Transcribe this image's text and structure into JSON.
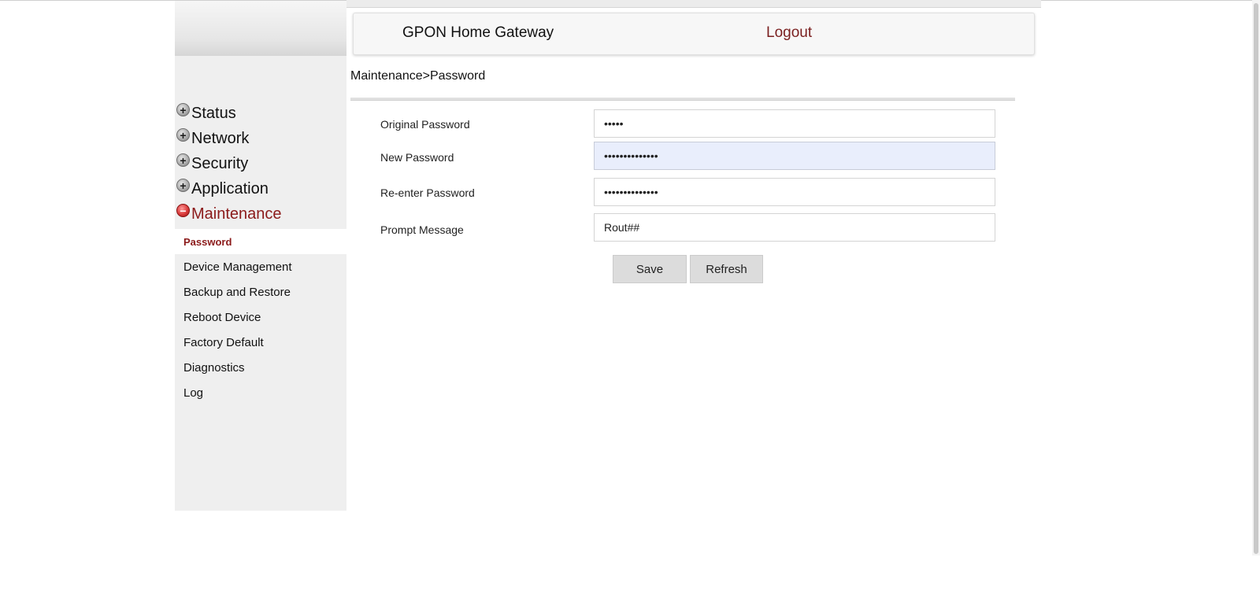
{
  "header": {
    "title": "GPON Home Gateway",
    "logout_label": "Logout"
  },
  "breadcrumb": "Maintenance>Password",
  "sidebar": {
    "menu": [
      {
        "label": "Status",
        "expander": "+"
      },
      {
        "label": "Network",
        "expander": "+"
      },
      {
        "label": "Security",
        "expander": "+"
      },
      {
        "label": "Application",
        "expander": "+"
      },
      {
        "label": "Maintenance",
        "expander": "−"
      }
    ],
    "maintenance_items": [
      {
        "label": "Password"
      },
      {
        "label": "Device Management"
      },
      {
        "label": "Backup and Restore"
      },
      {
        "label": "Reboot Device"
      },
      {
        "label": "Factory Default"
      },
      {
        "label": "Diagnostics"
      },
      {
        "label": "Log"
      }
    ]
  },
  "form": {
    "original_password": {
      "label": "Original Password",
      "value": "•••••"
    },
    "new_password": {
      "label": "New Password",
      "value": "••••••••••••••"
    },
    "reenter_password": {
      "label": "Re-enter Password",
      "value": "••••••••••••••"
    },
    "prompt_message": {
      "label": "Prompt Message",
      "value": "Rout##"
    }
  },
  "buttons": {
    "save_label": "Save",
    "refresh_label": "Refresh"
  },
  "colors": {
    "accent": "#8b1a1a",
    "focused_input": "#e9eefc",
    "sidebar_bg": "#efefef"
  }
}
